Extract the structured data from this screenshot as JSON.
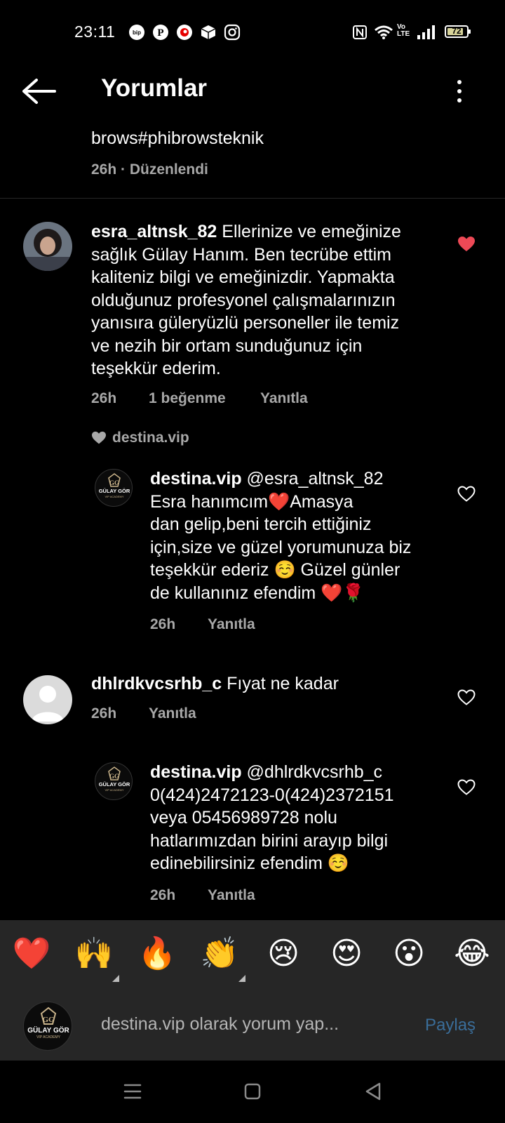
{
  "status_bar": {
    "time": "23:11",
    "battery": "72",
    "volte": "Vo\nLTE",
    "app_icons": [
      "bip-icon",
      "pinterest-icon",
      "vodafone-icon",
      "box-app-icon",
      "instagram-icon"
    ]
  },
  "header": {
    "title": "Yorumlar"
  },
  "caption": {
    "text": "brows#phibrowsteknik",
    "meta": "26h · Düzenlendi"
  },
  "comments": [
    {
      "username": "esra_altnsk_82",
      "text_first": "Ellerinize ve emeğinize",
      "lines": [
        "sağlık Gülay Hanım. Ben tecrübe ettim",
        "kaliteniz bilgi ve emeğinizdir. Yapmakta",
        "olduğunuz profesyonel çalışmalarınızın",
        "yanısıra  güleryüzlü personeller ile temiz",
        "ve nezih bir ortam sunduğunuz için",
        "teşekkür ederim."
      ],
      "time": "26h",
      "likes": "1 beğenme",
      "reply_label": "Yanıtla",
      "liked": true,
      "liked_by": "destina.vip"
    },
    {
      "username": "destina.vip",
      "mention": "@esra_altnsk_82",
      "lines": [
        "Esra hanımcım❤️Amasya",
        "dan gelip,beni tercih ettiğiniz",
        "için,size ve güzel yorumunuza biz",
        "teşekkür ederiz ☺️ Güzel günler",
        "de kullanınız efendim ❤️🌹"
      ],
      "time": "26h",
      "reply_label": "Yanıtla"
    },
    {
      "username": "dhlrdkvcsrhb_c",
      "text_first": "Fıyat ne kadar",
      "time": "26h",
      "reply_label": "Yanıtla"
    },
    {
      "username": "destina.vip",
      "mention": "@dhlrdkvcsrhb_c",
      "lines": [
        "0(424)2472123-0(424)2372151",
        "veya 05456989728 nolu",
        "hatlarımızdan birini arayıp bilgi",
        "edinebilirsiniz efendim ☺️"
      ],
      "time": "26h",
      "reply_label": "Yanıtla"
    }
  ],
  "logo": {
    "monogram": "GG",
    "brand": "GÜLAY GÖR",
    "sub": "VIP ACADEMY"
  },
  "emoji_bar": [
    "❤️",
    "🙌",
    "🔥",
    "👏",
    "😢",
    "😍",
    "😮",
    "😂"
  ],
  "comment_input": {
    "placeholder": "destina.vip olarak yorum yap...",
    "share_label": "Paylaş"
  },
  "colors": {
    "like_red": "#ed4956",
    "link_blue": "#3a6d99",
    "meta_gray": "#a8a8a8",
    "bar_bg": "#262626"
  }
}
